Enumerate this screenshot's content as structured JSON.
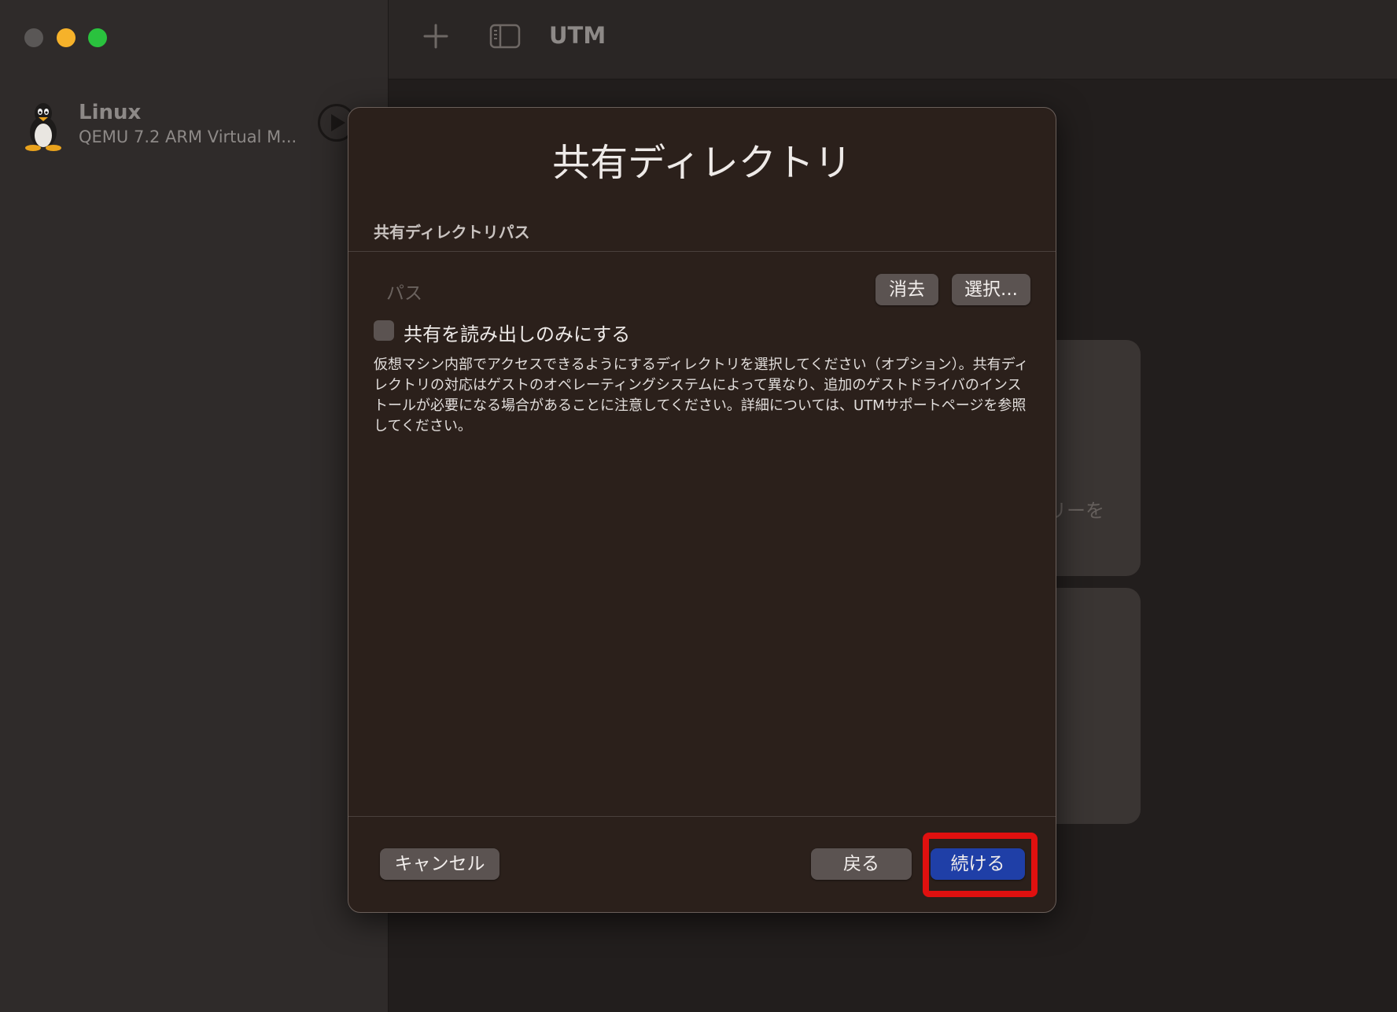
{
  "window": {
    "app_title": "UTM"
  },
  "sidebar": {
    "vm": {
      "name": "Linux",
      "subtitle": "QEMU 7.2 ARM Virtual M..."
    }
  },
  "background": {
    "partial_text": "リーを"
  },
  "dialog": {
    "title": "共有ディレクトリ",
    "section_label": "共有ディレクトリパス",
    "path_placeholder": "パス",
    "clear_label": "消去",
    "select_label": "選択...",
    "readonly_checkbox": {
      "label": "共有を読み出しのみにする",
      "checked": false
    },
    "description": "仮想マシン内部でアクセスできるようにするディレクトリを選択してください（オプション）。共有ディレクトリの対応はゲストのオペレーティングシステムによって異なり、追加のゲストドライバのインストールが必要になる場合があることに注意してください。詳細については、UTMサポートページを参照してください。",
    "cancel_label": "キャンセル",
    "back_label": "戻る",
    "continue_label": "続ける"
  },
  "colors": {
    "accent_button": "#1f3fa7",
    "highlight_box": "#e0100f",
    "traffic_close": "#5a5756",
    "traffic_minimize": "#f6b22a",
    "traffic_maximize": "#2ac23e"
  },
  "icons": [
    "tux-penguin-icon",
    "play-icon",
    "plus-icon",
    "sidebar-toggle-icon"
  ]
}
